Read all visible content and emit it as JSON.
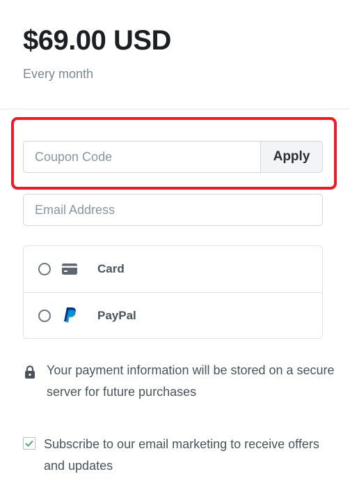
{
  "pricing": {
    "amount": "$69.00 USD",
    "period": "Every month"
  },
  "coupon": {
    "placeholder": "Coupon Code",
    "value": "",
    "apply_label": "Apply"
  },
  "email": {
    "placeholder": "Email Address",
    "value": ""
  },
  "payment_methods": [
    {
      "label": "Card",
      "icon": "credit-card-icon",
      "selected": false
    },
    {
      "label": "PayPal",
      "icon": "paypal-icon",
      "selected": false
    }
  ],
  "secure_note": {
    "icon": "lock-icon",
    "text": "Your payment information will be stored on a secure server for future purchases"
  },
  "subscribe": {
    "checked": true,
    "text": "Subscribe to our email marketing to receive offers and updates"
  },
  "colors": {
    "highlight": "#ef1b24",
    "paypal_dark": "#003087",
    "paypal_light": "#009cde",
    "check": "#3aa757"
  }
}
